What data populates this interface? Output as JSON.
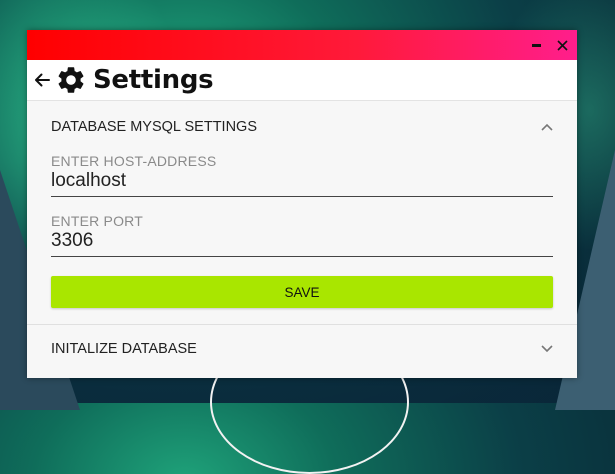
{
  "window": {
    "title": "Settings",
    "minimize_icon": "minimize-icon",
    "close_icon": "close-icon",
    "titlebar_gradient": [
      "#ff0000",
      "#ff1e8c"
    ]
  },
  "header": {
    "back_icon": "arrow-left-icon",
    "settings_icon": "gear-icon",
    "title": "Settings"
  },
  "sections": {
    "mysql": {
      "title": "DATABASE MYSQL SETTINGS",
      "expanded": true,
      "host": {
        "label": "ENTER HOST-ADDRESS",
        "value": "localhost"
      },
      "port": {
        "label": "ENTER PORT",
        "value": "3306"
      },
      "save_label": "SAVE",
      "save_color": "#a9e600"
    },
    "init": {
      "title": "INITALIZE DATABASE",
      "expanded": false
    }
  }
}
